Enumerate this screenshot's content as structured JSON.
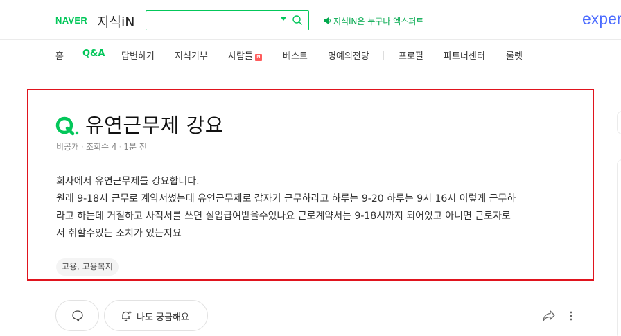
{
  "header": {
    "brand": "NAVER",
    "service": "지식iN",
    "search_value": "",
    "notice": "지식iN은 누구나 엑스퍼트",
    "expert_logo": "exper"
  },
  "nav": {
    "items": [
      "홈",
      "Q&A",
      "답변하기",
      "지식기부",
      "사람들",
      "베스트",
      "명예의전당",
      "프로필",
      "파트너센터",
      "룰렛"
    ],
    "active_index": 1,
    "new_badge": "N"
  },
  "question": {
    "title": "유연근무제 강요",
    "meta": {
      "visibility": "비공개",
      "views": "조회수 4",
      "time": "1분 전"
    },
    "body_lines": [
      "회사에서 유연근무제를 강요합니다.",
      "원래 9-18시 근무로 계약서썼는데 유연근무제로 갑자기 근무하라고 하루는 9-20 하루는 9시 16시 이렇게 근무하",
      "라고 하는데 거절하고 사직서를 쓰면 실업급여받을수있나요 근로계약서는 9-18시까지 되어있고 아니면 근로자로",
      "서 취할수있는 조치가 있는지요"
    ],
    "tag": "고용, 고용복지"
  },
  "actions": {
    "curious_label": "나도 궁금해요"
  },
  "colors": {
    "brand_green": "#03c75a",
    "highlight_red": "#e0141e",
    "expert_blue": "#4b6bff"
  }
}
